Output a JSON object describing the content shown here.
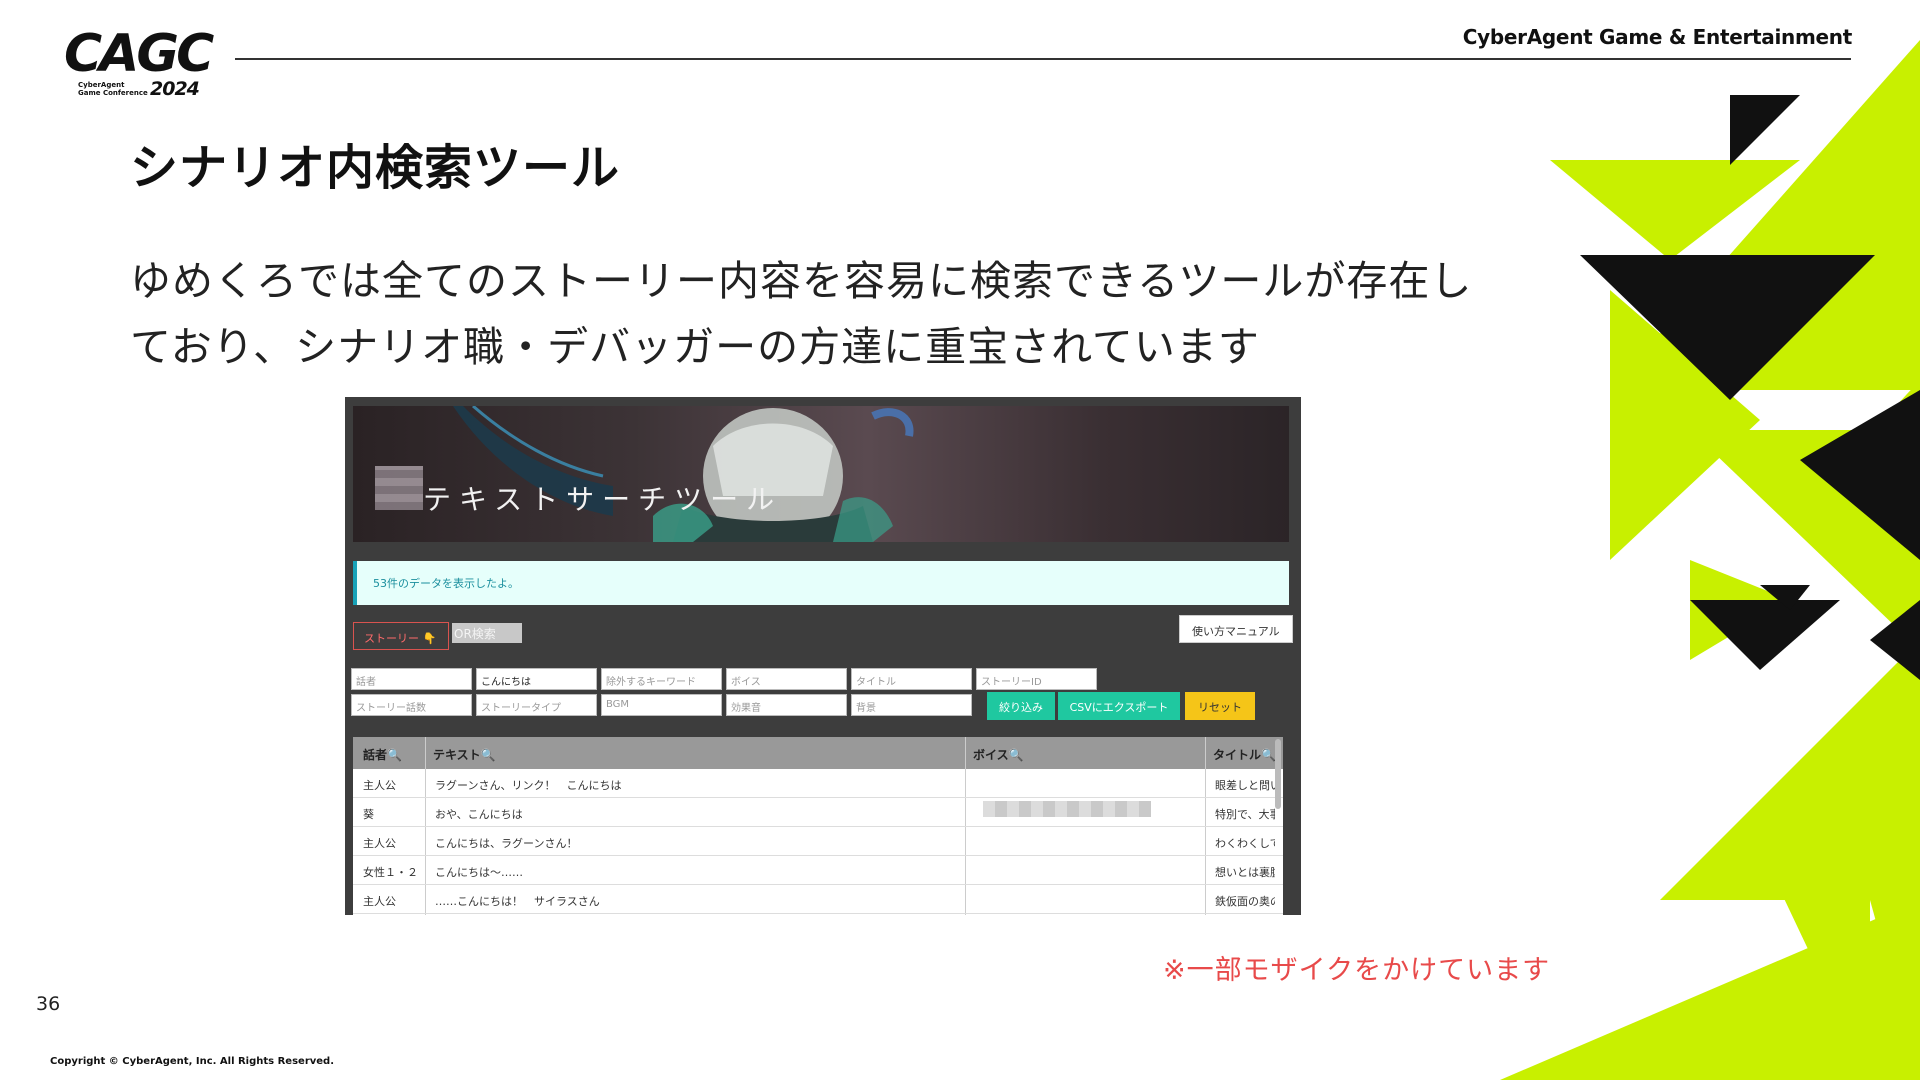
{
  "header": {
    "logo_main": "CAGC",
    "logo_sub1": "CyberAgent",
    "logo_sub2": "Game Conference",
    "logo_year": "2024",
    "brand": "CyberAgent Game & Entertainment"
  },
  "slide": {
    "title": "シナリオ内検索ツール",
    "body_line1": "ゆめくろでは全てのストーリー内容を容易に検索できるツールが存在し",
    "body_line2": "ており、シナリオ職・デバッガーの方達に重宝されています",
    "note": "※一部モザイクをかけています",
    "page_number": "36",
    "copyright": "Copyright © CyberAgent, Inc. All Rights Reserved."
  },
  "tool": {
    "banner_title": "テキストサーチツール",
    "alert": "53件のデータを表示したよ。",
    "story_button": "ストーリー 👇",
    "or_search": "OR検索",
    "manual_button": "使い方マニュアル",
    "fields_row1": [
      "話者",
      "こんにちは",
      "除外するキーワード",
      "ボイス",
      "タイトル",
      "ストーリーID"
    ],
    "fields_row2": [
      "ストーリー話数",
      "ストーリータイプ",
      "BGM",
      "効果音",
      "背景"
    ],
    "filter_button": "絞り込み",
    "csv_button": "CSVにエクスポート",
    "reset_button": "リセット",
    "columns": [
      "話者🔍",
      "テキスト🔍",
      "ボイス🔍",
      "タイトル🔍"
    ],
    "rows": [
      {
        "speaker": "主人公",
        "text": "ラグーンさん、リンク！　こんにちは",
        "title": "眼差しと問い"
      },
      {
        "speaker": "葵",
        "text": "おや、こんにちは",
        "title": "特別で、大事"
      },
      {
        "speaker": "主人公",
        "text": "こんにちは、ラグーンさん！",
        "title": "わくわくして"
      },
      {
        "speaker": "女性１・２",
        "text": "こんにちは〜……",
        "title": "想いとは裏腹"
      },
      {
        "speaker": "主人公",
        "text": "……こんにちは！　サイラスさん",
        "title": "鉄仮面の奥の"
      }
    ]
  },
  "colors": {
    "accent_lime": "#c8f000",
    "note_red": "#e84a4a",
    "button_teal": "#1fc8a0",
    "button_yellow": "#f5c518"
  }
}
